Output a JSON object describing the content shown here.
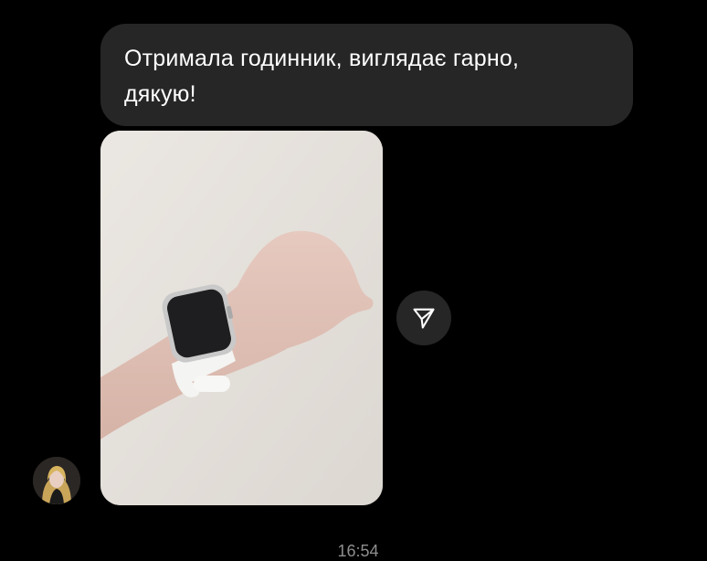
{
  "message": {
    "text_line1": "Отримала годинник, виглядає гарно,",
    "text_line2": "дякую!"
  },
  "timestamp": "16:54",
  "icons": {
    "share": "send-arrow-icon",
    "avatar": "user-avatar"
  },
  "colors": {
    "background": "#000000",
    "bubble": "#262626",
    "text": "#ffffff",
    "timestamp": "#8e8e8e"
  }
}
